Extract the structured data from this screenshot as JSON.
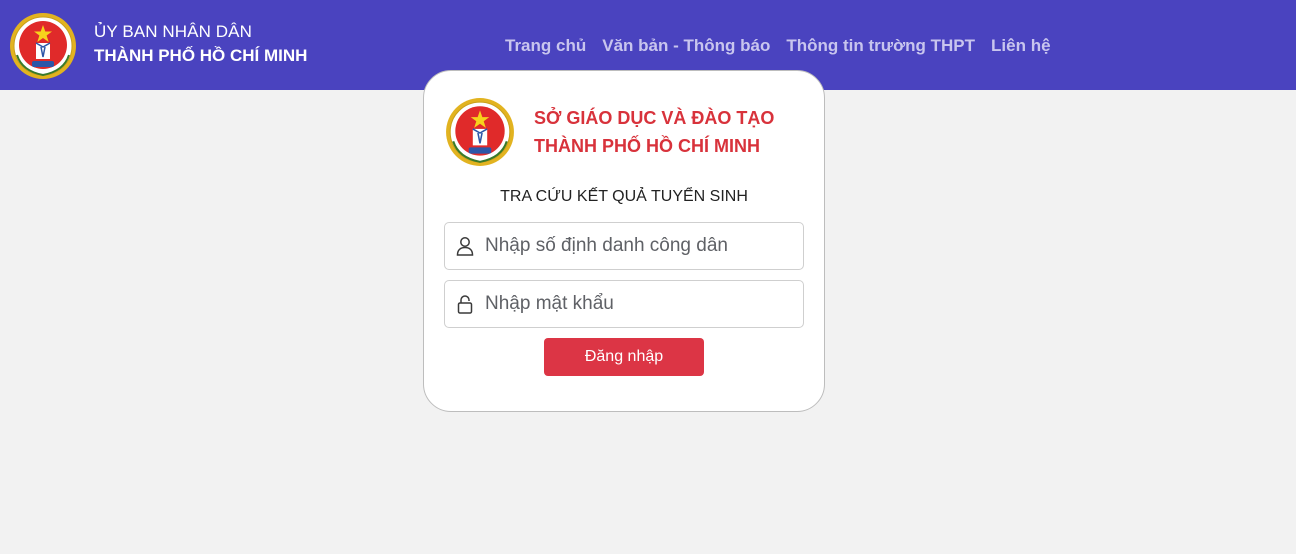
{
  "header": {
    "line1": "ỦY BAN NHÂN DÂN",
    "line2": "THÀNH PHỐ HỒ CHÍ MINH",
    "nav": [
      {
        "label": "Trang chủ"
      },
      {
        "label": "Văn bản - Thông báo"
      },
      {
        "label": "Thông tin trường THPT"
      },
      {
        "label": "Liên hệ"
      }
    ]
  },
  "card": {
    "org_line1": "SỞ GIÁO DỤC VÀ ĐÀO TẠO",
    "org_line2": "THÀNH PHỐ HỒ CHÍ MINH",
    "title": "TRA CỨU KẾT QUẢ TUYỂN SINH",
    "id_field": {
      "value": "",
      "placeholder": "Nhập số định danh công dân"
    },
    "password_field": {
      "value": "",
      "placeholder": "Nhập mật khẩu"
    },
    "login_label": "Đăng nhập"
  },
  "colors": {
    "header_bg": "#4a43bf",
    "accent_red": "#dc3545",
    "org_text": "#d8323b",
    "emblem_gold": "#e2b320"
  },
  "icons": {
    "header_logo": "education-emblem-icon",
    "card_logo": "education-emblem-icon",
    "id_field": "user-icon",
    "password_field": "lock-icon"
  }
}
